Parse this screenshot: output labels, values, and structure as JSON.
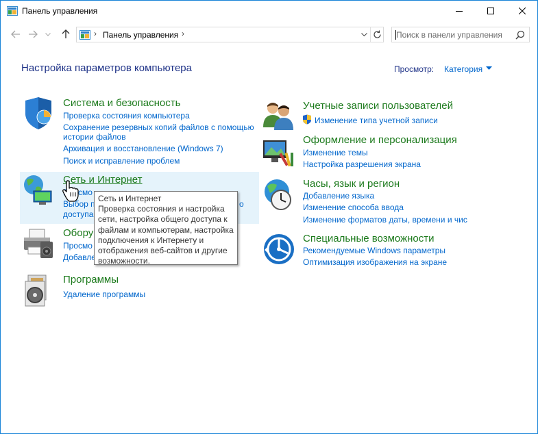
{
  "window": {
    "title": "Панель управления"
  },
  "address_bar": {
    "path": "Панель управления",
    "separator": "›"
  },
  "search": {
    "placeholder": "Поиск в панели управления"
  },
  "content": {
    "heading": "Настройка параметров компьютера",
    "view_label": "Просмотр:",
    "view_value": "Категория"
  },
  "categories": [
    {
      "title": "Система и безопасность",
      "icon": "shield-icon",
      "links": [
        "Проверка состояния компьютера",
        "Сохранение резервных копий файлов с помощью",
        "истории файлов",
        "Архивация и восстановление (Windows 7)",
        "Поиск и исправление проблем"
      ]
    },
    {
      "title": "Сеть и Интернет",
      "icon": "network-globe-icon",
      "links": [
        "Просмотр состояния сети и задач",
        "Выбор параметров домашней группы и общего",
        "доступа"
      ],
      "links_visible": [
        "Просмо",
        "Выбор п",
        "доступа"
      ],
      "links_visible_suffix": [
        "о"
      ]
    },
    {
      "title": "Оборудование и звук",
      "title_visible": "Обору",
      "icon": "printer-icon",
      "links_visible": [
        "Просмо",
        "Добавле"
      ]
    },
    {
      "title": "Программы",
      "icon": "programs-disc-icon",
      "links": [
        "Удаление программы"
      ]
    },
    {
      "title": "Учетные записи пользователей",
      "icon": "users-icon",
      "links": [
        "Изменение типа учетной записи"
      ]
    },
    {
      "title": "Оформление и персонализация",
      "icon": "personalization-monitor-icon",
      "links": [
        "Изменение темы",
        "Настройка разрешения экрана"
      ]
    },
    {
      "title": "Часы, язык и регион",
      "icon": "clock-globe-icon",
      "links": [
        "Добавление языка",
        "Изменение способа ввода",
        "Изменение форматов даты, времени и чис"
      ]
    },
    {
      "title": "Специальные возможности",
      "icon": "accessibility-icon",
      "links": [
        "Рекомендуемые Windows параметры",
        "Оптимизация изображения на экране"
      ]
    }
  ],
  "tooltip": {
    "title": "Сеть и Интернет",
    "lines": [
      "Проверка состояния и настройка",
      "сети, настройка общего доступа к",
      "файлам и компьютерам, настройка",
      "подключения к Интернету и",
      "отображения веб-сайтов и другие",
      "возможности."
    ]
  },
  "colors": {
    "category_title": "#1c7a1c",
    "link": "#0066cc",
    "heading": "#1e3287",
    "hover_highlight": "#e5f3fb",
    "window_border": "#1883d7"
  }
}
